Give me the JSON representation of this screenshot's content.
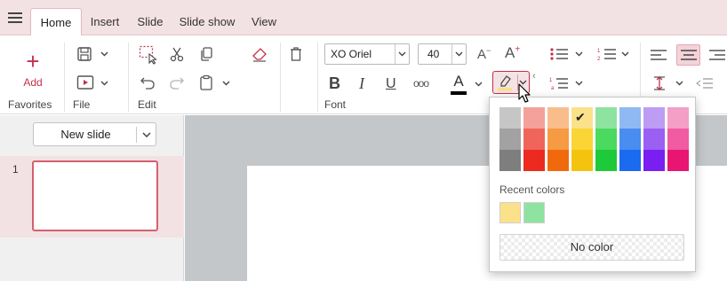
{
  "tabs": [
    {
      "label": "Home",
      "active": true
    },
    {
      "label": "Insert"
    },
    {
      "label": "Slide"
    },
    {
      "label": "Slide show"
    },
    {
      "label": "View"
    }
  ],
  "ribbon": {
    "groups": {
      "favorites": "Favorites",
      "file": "File",
      "edit": "Edit",
      "font": "Font"
    },
    "add_label": "Add",
    "font_name": "XO Oriel",
    "font_size": "40",
    "bold_glyph": "B",
    "italic_glyph": "I",
    "underline_glyph": "U",
    "more_glyph": "ooo",
    "font_color_glyph": "A",
    "font_color": "#000000",
    "grow_glyph": "A",
    "shrink_glyph": "A",
    "accent_color": "#c4314b"
  },
  "slides_panel": {
    "new_slide_label": "New slide",
    "slides": [
      {
        "number": "1"
      }
    ]
  },
  "color_popup": {
    "colors": [
      [
        "#c6c6c6",
        "#f4a19a",
        "#f9bd8c",
        "#fbe189",
        "#8ee3a1",
        "#8fb9f2",
        "#bd9cf4",
        "#f39fc6"
      ],
      [
        "#a2a2a2",
        "#f0655b",
        "#f79a44",
        "#fad535",
        "#4ada5f",
        "#4a8df0",
        "#9a60f3",
        "#f05ba1"
      ],
      [
        "#7e7e7e",
        "#ec2a20",
        "#f06a0d",
        "#f4c30d",
        "#1ec93a",
        "#1a6bf0",
        "#7a1ef1",
        "#e81672"
      ]
    ],
    "selected": [
      0,
      3
    ],
    "recent_label": "Recent colors",
    "recent_colors": [
      "#fbe189",
      "#8ee3a1"
    ],
    "no_color_label": "No color"
  }
}
